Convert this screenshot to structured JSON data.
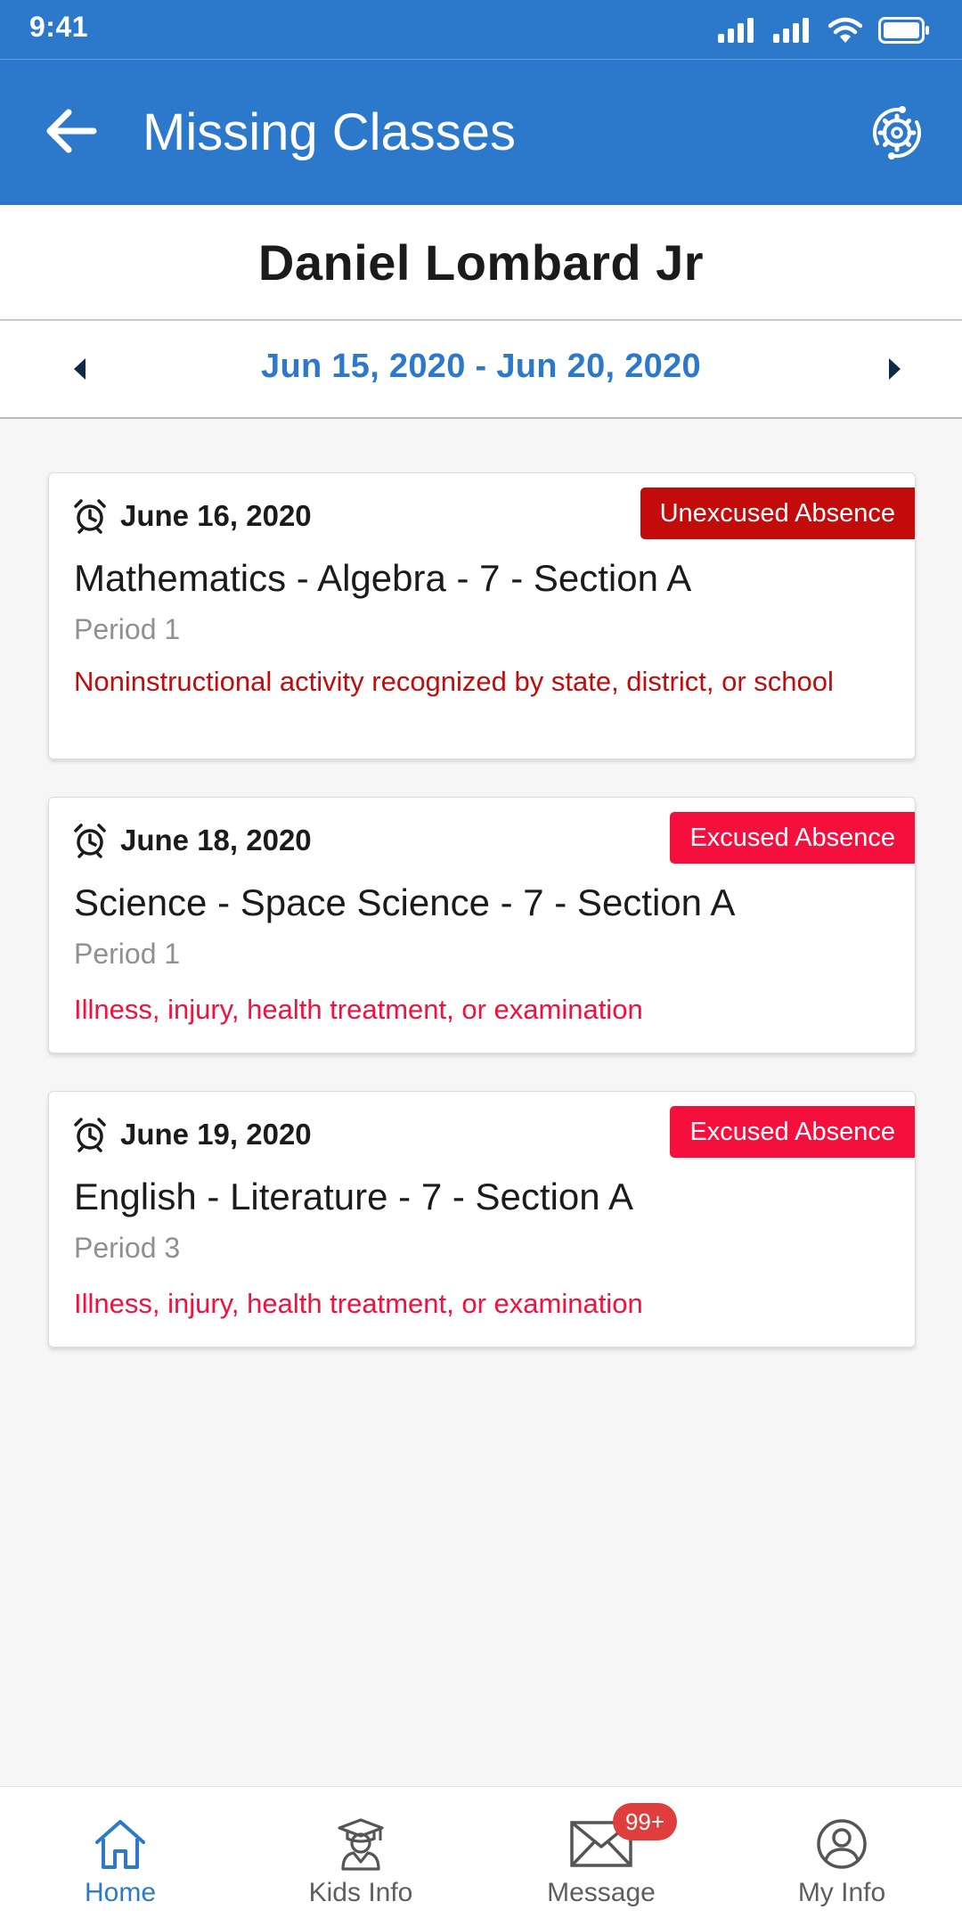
{
  "status_bar": {
    "time": "9:41"
  },
  "app_bar": {
    "title": "Missing Classes"
  },
  "student": {
    "name": "Daniel Lombard Jr"
  },
  "date_range": {
    "label": "Jun 15, 2020 - Jun 20, 2020"
  },
  "colors": {
    "primary": "#2c78cb",
    "unexcused": "#c40b0b",
    "excused": "#f50f3d"
  },
  "records": [
    {
      "date": "June 16, 2020",
      "status": "Unexcused Absence",
      "course": "Mathematics - Algebra - 7 - Section A",
      "period": "Period 1",
      "reason": "Noninstructional activity recognized by state, district, or school"
    },
    {
      "date": "June 18, 2020",
      "status": "Excused Absence",
      "course": "Science - Space Science - 7 - Section A",
      "period": "Period 1",
      "reason": "Illness, injury, health treatment, or examination"
    },
    {
      "date": "June 19, 2020",
      "status": "Excused Absence",
      "course": "English - Literature - 7 - Section A",
      "period": "Period 3",
      "reason": "Illness, injury, health treatment, or examination"
    }
  ],
  "bottom_nav": {
    "items": [
      {
        "label": "Home",
        "icon": "home-icon",
        "active": true
      },
      {
        "label": "Kids Info",
        "icon": "graduate-icon",
        "active": false
      },
      {
        "label": "Message",
        "icon": "envelope-icon",
        "active": false,
        "badge": "99+"
      },
      {
        "label": "My Info",
        "icon": "user-circle-icon",
        "active": false
      }
    ]
  }
}
